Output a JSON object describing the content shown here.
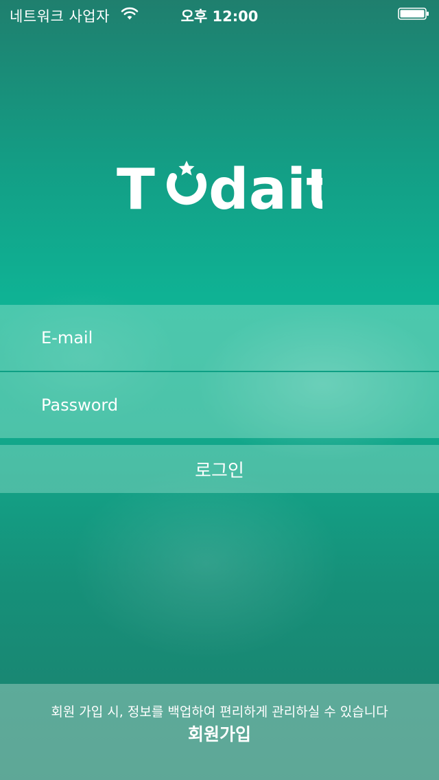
{
  "status_bar": {
    "carrier": "네트워크 사업자",
    "time": "오후 12:00",
    "wifi_icon": "wifi-icon",
    "battery_icon": "battery-icon"
  },
  "logo": {
    "text_left": "T",
    "text_right": "dait",
    "mark_icon": "clock-star-icon"
  },
  "form": {
    "email_placeholder": "E-mail",
    "email_value": "",
    "password_placeholder": "Password",
    "password_value": "",
    "login_label": "로그인"
  },
  "signup": {
    "hint": "회원 가입 시, 정보를 백업하여 편리하게 관리하실 수 있습니다",
    "button_label": "회원가입"
  },
  "colors": {
    "accent": "#0fb294",
    "dark": "#1c7f6d",
    "text": "#ffffff"
  }
}
